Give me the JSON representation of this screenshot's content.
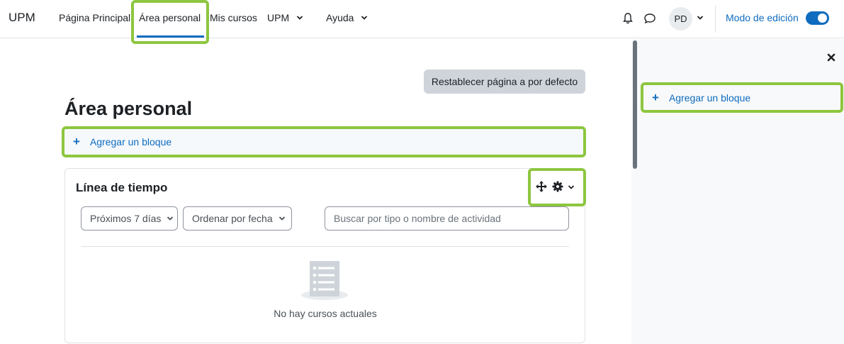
{
  "navbar": {
    "brand": "UPM",
    "items": [
      {
        "label": "Página Principal"
      },
      {
        "label": "Área personal"
      },
      {
        "label": "Mis cursos"
      },
      {
        "label": "UPM"
      },
      {
        "label": "Ayuda"
      }
    ],
    "avatar_initials": "PD",
    "edit_mode_label": "Modo de edición"
  },
  "main": {
    "reset_button": "Restablecer página a por defecto",
    "title": "Área personal",
    "add_block": "Agregar un bloque"
  },
  "timeline": {
    "title": "Línea de tiempo",
    "filter_select": "Próximos 7 días",
    "sort_select": "Ordenar por fecha",
    "search_placeholder": "Buscar por tipo o nombre de actividad",
    "empty_text": "No hay cursos actuales"
  },
  "drawer": {
    "add_block": "Agregar un bloque"
  },
  "colors": {
    "accent": "#0f6cbf",
    "highlight": "#8dc63f"
  }
}
